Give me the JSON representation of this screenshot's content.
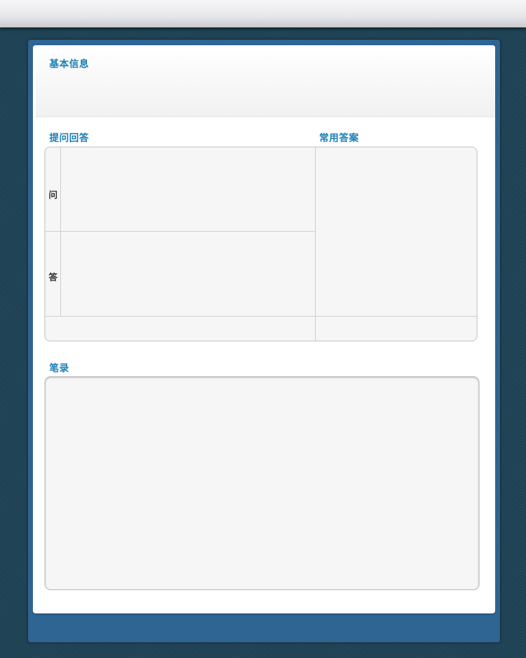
{
  "sections": {
    "basic_info": {
      "title": "基本信息"
    },
    "qa": {
      "title": "提问回答",
      "question_label": "问",
      "answer_label": "答"
    },
    "common_answers": {
      "title": "常用答案"
    },
    "notes": {
      "title": "笔录"
    }
  }
}
